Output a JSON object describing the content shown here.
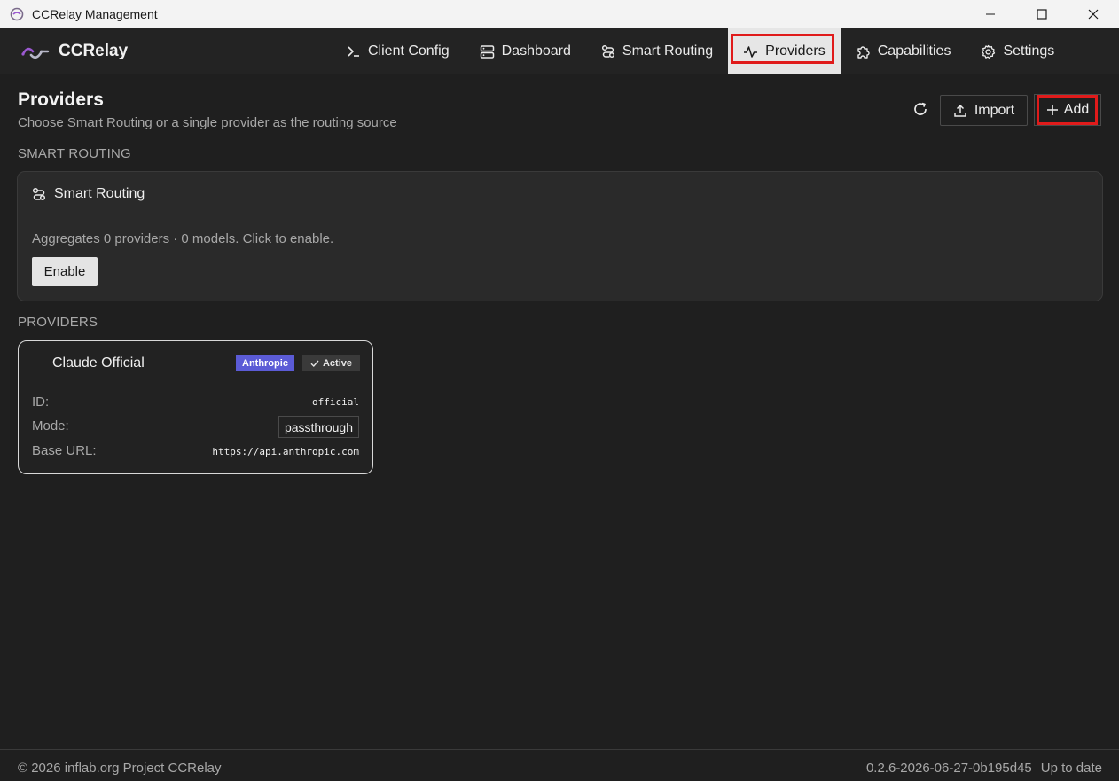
{
  "window": {
    "title": "CCRelay Management"
  },
  "brand": {
    "name": "CCRelay",
    "accent": "#9b59d0"
  },
  "nav": {
    "items": [
      {
        "label": "Client Config",
        "icon": "terminal-icon"
      },
      {
        "label": "Dashboard",
        "icon": "server-icon"
      },
      {
        "label": "Smart Routing",
        "icon": "route-icon"
      },
      {
        "label": "Providers",
        "icon": "activity-icon",
        "active": true
      },
      {
        "label": "Capabilities",
        "icon": "puzzle-icon"
      },
      {
        "label": "Settings",
        "icon": "gear-icon"
      }
    ]
  },
  "page": {
    "title": "Providers",
    "subtitle": "Choose Smart Routing or a single provider as the routing source"
  },
  "actions": {
    "import_label": "Import",
    "add_label": "Add"
  },
  "smart_routing": {
    "section_label": "SMART ROUTING",
    "card_title": "Smart Routing",
    "description": "Aggregates 0 providers · 0 models. Click to enable.",
    "enable_label": "Enable"
  },
  "providers": {
    "section_label": "PROVIDERS",
    "items": [
      {
        "name": "Claude Official",
        "badge": "Anthropic",
        "status": "Active",
        "id_label": "ID:",
        "id": "official",
        "mode_label": "Mode:",
        "mode": "passthrough",
        "base_url_label": "Base URL:",
        "base_url": "https://api.anthropic.com"
      }
    ]
  },
  "footer": {
    "copyright": "© 2026 inflab.org Project CCRelay",
    "version": "0.2.6-2026-06-27-0b195d45",
    "update_status": "Up to date"
  },
  "colors": {
    "background": "#1f1f1f",
    "badge_brand": "#5b5bd6",
    "highlight": "#e01b1b"
  }
}
